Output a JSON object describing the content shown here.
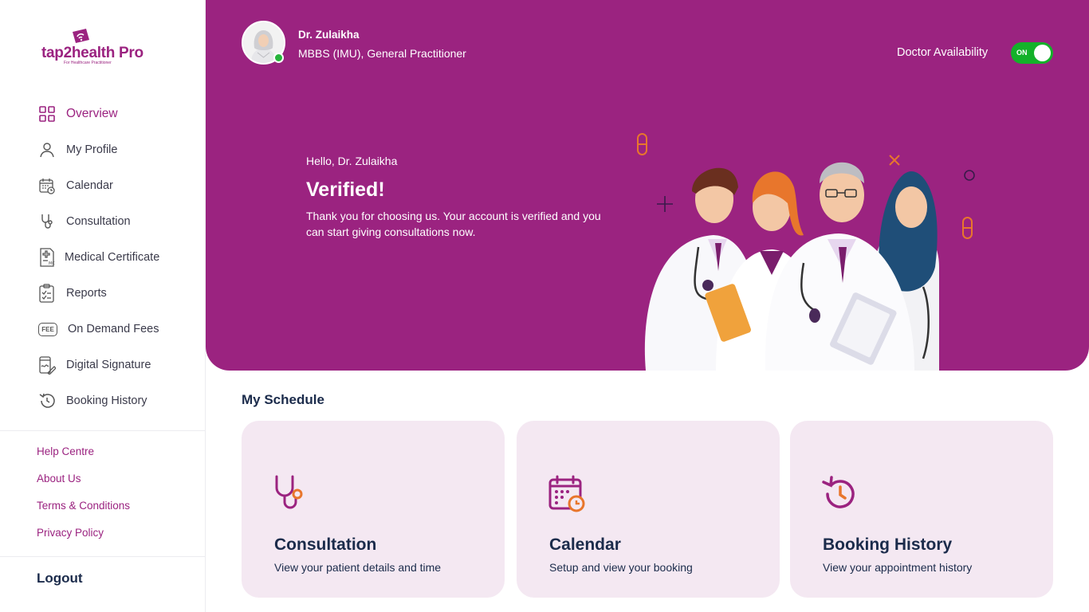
{
  "brand": {
    "name": "tap2health Pro",
    "tagline": "For Healthcare Practitioner"
  },
  "sidebar": {
    "items": [
      {
        "label": "Overview",
        "icon": "grid-icon",
        "active": true
      },
      {
        "label": "My Profile",
        "icon": "user-icon"
      },
      {
        "label": "Calendar",
        "icon": "calendar-icon"
      },
      {
        "label": "Consultation",
        "icon": "stethoscope-icon"
      },
      {
        "label": "Medical Certificate",
        "icon": "certificate-icon"
      },
      {
        "label": "Reports",
        "icon": "clipboard-icon"
      },
      {
        "label": "On Demand Fees",
        "icon": "fee-icon",
        "icon_text": "FEE"
      },
      {
        "label": "Digital Signature",
        "icon": "signature-icon"
      },
      {
        "label": "Booking History",
        "icon": "history-icon"
      }
    ],
    "links": [
      "Help Centre",
      "About Us",
      "Terms & Conditions",
      "Privacy Policy"
    ],
    "logout": "Logout"
  },
  "header": {
    "doctor_name": "Dr. Zulaikha",
    "doctor_qualification": "MBBS (IMU), General Practitioner",
    "availability_label": "Doctor Availability",
    "availability_state": "ON"
  },
  "banner": {
    "greeting": "Hello, Dr. Zulaikha",
    "title": "Verified!",
    "message": "Thank you for choosing us. Your account is verified and you can start giving consultations now."
  },
  "schedule": {
    "title": "My Schedule",
    "cards": [
      {
        "title": "Consultation",
        "subtitle": "View your patient details and time",
        "icon": "stethoscope-icon"
      },
      {
        "title": "Calendar",
        "subtitle": "Setup and view your booking",
        "icon": "calendar-clock-icon"
      },
      {
        "title": "Booking History",
        "subtitle": "View your appointment history",
        "icon": "history-icon"
      }
    ]
  },
  "colors": {
    "primary": "#9b2380",
    "navy": "#1b2b4b",
    "toggle_on": "#14b12a",
    "card_bg": "#f4e8f2",
    "accent_orange": "#e8762c"
  }
}
